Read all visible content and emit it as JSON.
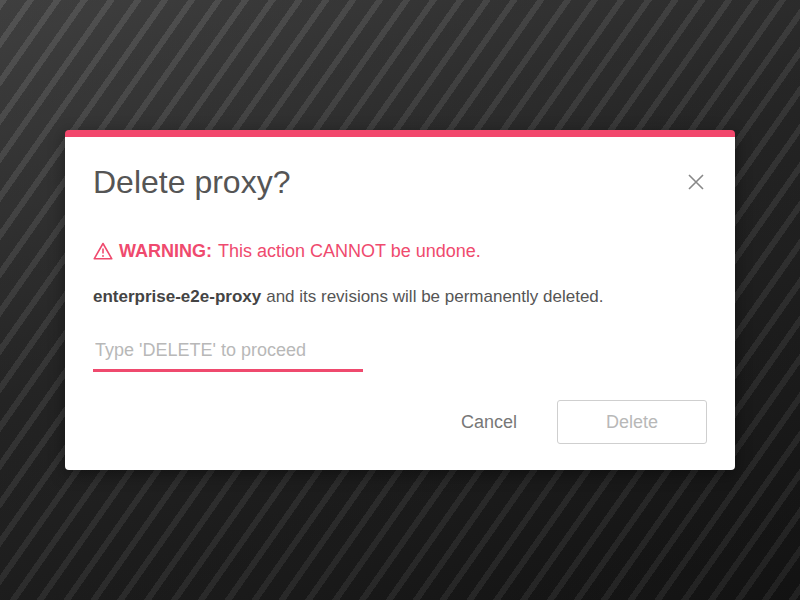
{
  "dialog": {
    "title": "Delete proxy?",
    "warning": {
      "label": "WARNING:",
      "message": "This action CANNOT be undone."
    },
    "description": {
      "resource": "enterprise-e2e-proxy",
      "text": "and its revisions will be permanently deleted."
    },
    "input": {
      "placeholder": "Type 'DELETE' to proceed",
      "value": "",
      "focused": true
    },
    "buttons": [
      {
        "label": "Cancel",
        "kind": "text",
        "disabled": false
      },
      {
        "label": "Delete",
        "kind": "outlined",
        "disabled": true
      }
    ]
  }
}
